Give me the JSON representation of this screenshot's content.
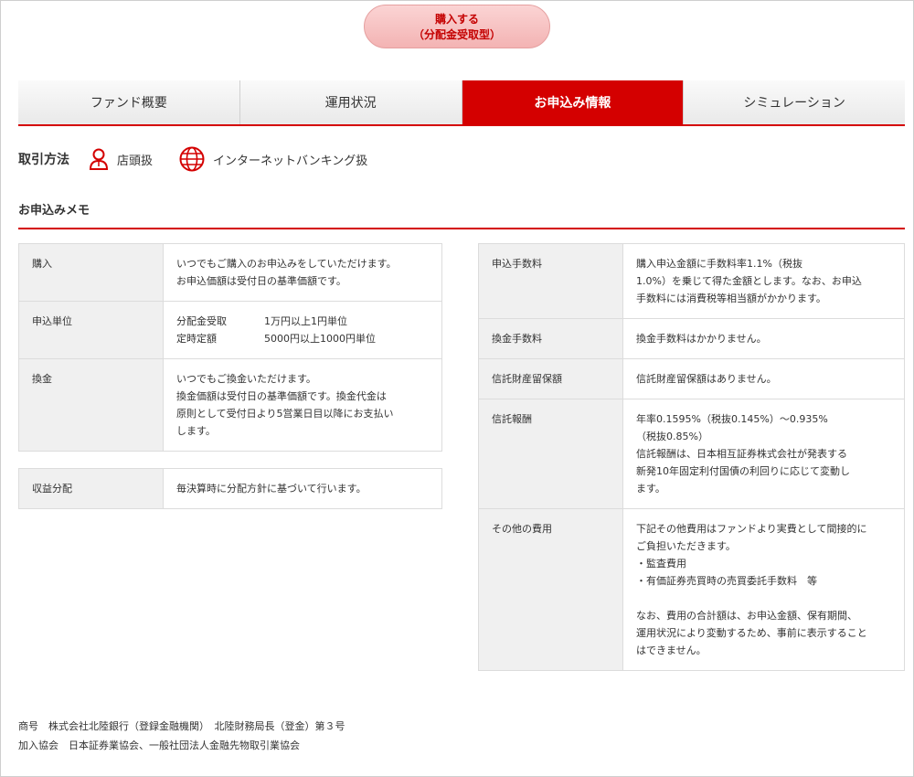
{
  "buy_button": {
    "line1": "購入する",
    "line2": "（分配金受取型）"
  },
  "tabs": [
    {
      "label": "ファンド概要",
      "active": false
    },
    {
      "label": "運用状況",
      "active": false
    },
    {
      "label": "お申込み情報",
      "active": true
    },
    {
      "label": "シミュレーション",
      "active": false
    }
  ],
  "trade_method": {
    "label": "取引方法",
    "store": "店頭扱",
    "internet": "インターネットバンキング扱"
  },
  "memo_title": "お申込みメモ",
  "left_table": {
    "purchase": {
      "header": "購入",
      "lines": [
        "いつでもご購入のお申込みをしていただけます。",
        "お申込価額は受付日の基準価額です。"
      ]
    },
    "unit": {
      "header": "申込単位",
      "rows": [
        {
          "key": "分配金受取",
          "value": "1万円以上1円単位"
        },
        {
          "key": "定時定額",
          "value": "5000円以上1000円単位"
        }
      ]
    },
    "redemption": {
      "header": "換金",
      "lines": [
        "いつでもご換金いただけます。",
        "換金価額は受付日の基準価額です。換金代金は",
        "原則として受付日より5営業日目以降にお支払い",
        "します。"
      ]
    },
    "distribution": {
      "header": "収益分配",
      "lines": [
        "毎決算時に分配方針に基づいて行います。"
      ]
    }
  },
  "right_table": {
    "fee": {
      "header": "申込手数料",
      "lines": [
        "購入申込金額に手数料率1.1%（税抜",
        "1.0%）を乗じて得た金額とします。なお、お申込",
        "手数料には消費税等相当額がかかります。"
      ]
    },
    "redemption_fee": {
      "header": "換金手数料",
      "lines": [
        "換金手数料はかかりません。"
      ]
    },
    "trust_reserve": {
      "header": "信託財産留保額",
      "lines": [
        "信託財産留保額はありません。"
      ]
    },
    "trust_fee": {
      "header": "信託報酬",
      "lines": [
        "年率0.1595%（税抜0.145%）～0.935%",
        "（税抜0.85%）",
        "信託報酬は、日本相互証券株式会社が発表する",
        "新発10年固定利付国債の利回りに応じて変動し",
        "ます。"
      ]
    },
    "other": {
      "header": "その他の費用",
      "lines": [
        "下記その他費用はファンドより実費として間接的に",
        "ご負担いただきます。",
        "・監査費用",
        "・有価証券売買時の売買委託手数料　等",
        "",
        "なお、費用の合計額は、お申込金額、保有期間、",
        "運用状況により変動するため、事前に表示すること",
        "はできません。"
      ]
    }
  },
  "footer": {
    "line1": "商号　株式会社北陸銀行（登録金融機関）　北陸財務局長（登金）第３号",
    "line2": "加入協会　日本証券業協会、一般社団法人金融先物取引業協会"
  },
  "colors": {
    "accent": "#d40000",
    "header_bg": "#f0f0f0",
    "button_pink": "#f3b3b3"
  },
  "icons": {
    "store": "person-icon",
    "internet": "globe-icon"
  }
}
